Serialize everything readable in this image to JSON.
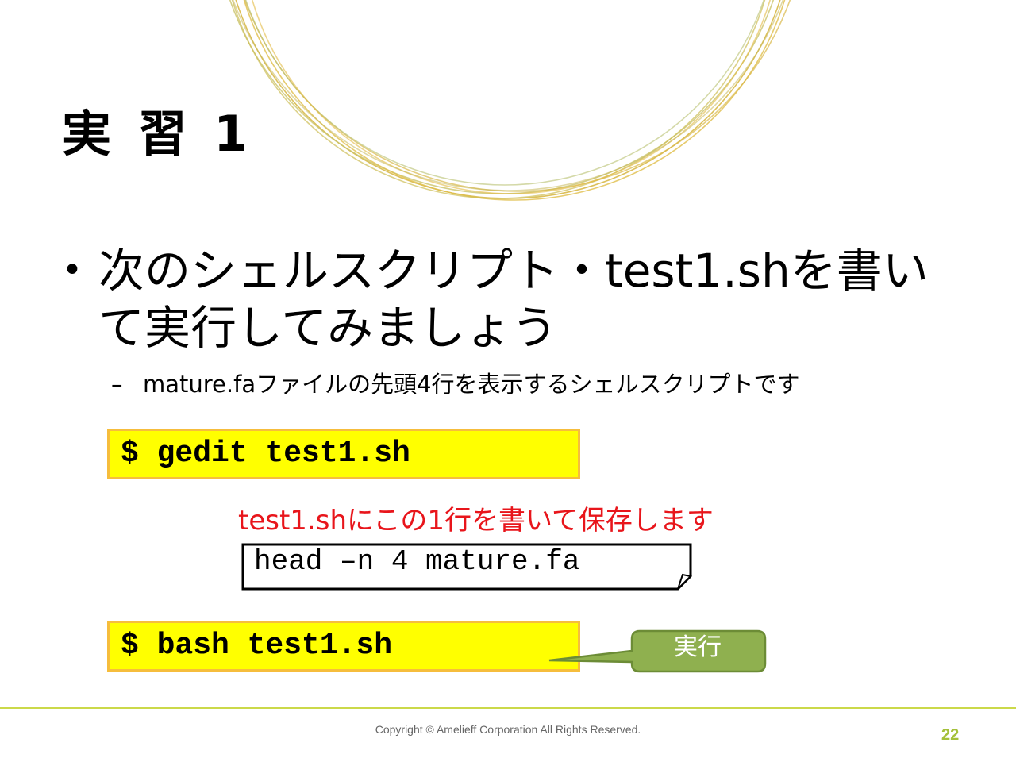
{
  "slide": {
    "title": "実 習 1",
    "bullet": "次のシェルスクリプト・test1.shを書いて実行してみましょう",
    "sub_dash": "–",
    "sub_bullet": "mature.faファイルの先頭4行を表示するシェルスクリプトです",
    "cmd1": "$ gedit test1.sh",
    "note": "test1.shにこの1行を書いて保存します",
    "code": "head –n 4 mature.fa",
    "cmd2": "$ bash test1.sh",
    "callout": "実行",
    "copyright": "Copyright © Amelieff Corporation All Rights Reserved.",
    "page_number": "22"
  },
  "colors": {
    "command_box_fill": "#ffff00",
    "command_box_border": "#f6bd3c",
    "note_text": "#e8151b",
    "callout_fill": "#8fb04f",
    "accent_green": "#a4c03a",
    "decoration_gold": "#d4b43a"
  }
}
